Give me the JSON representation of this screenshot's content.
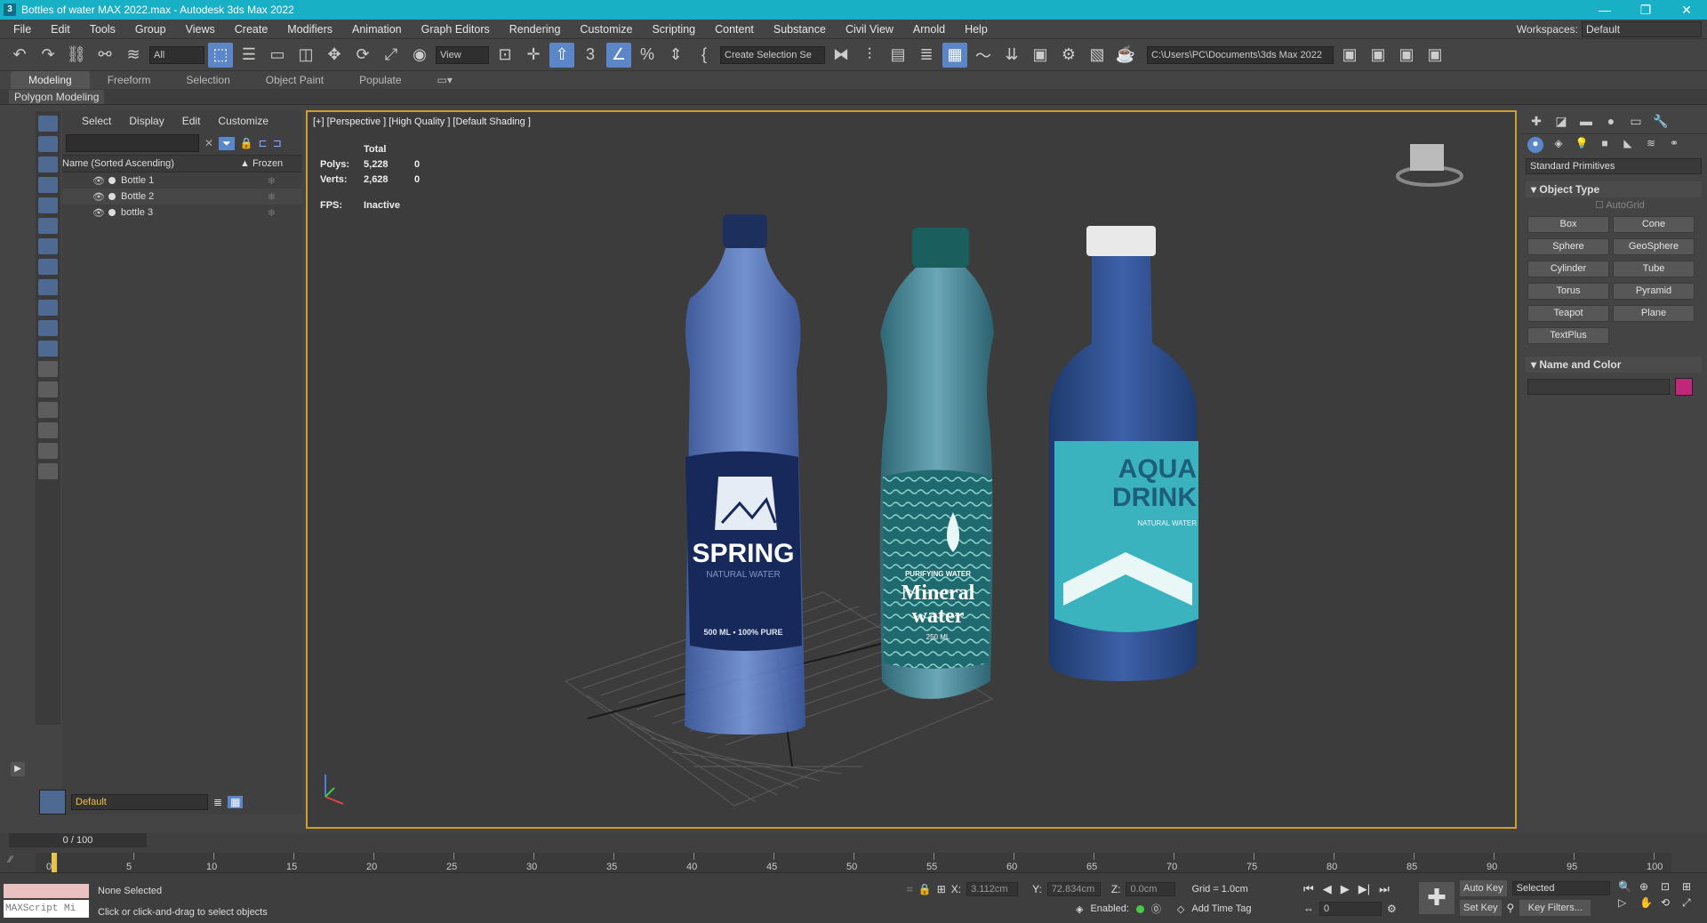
{
  "window": {
    "title": "Bottles of water MAX 2022.max - Autodesk 3ds Max 2022",
    "logo_text": "3",
    "controls": [
      "—",
      "❐",
      "✕"
    ]
  },
  "menu": {
    "items": [
      "File",
      "Edit",
      "Tools",
      "Group",
      "Views",
      "Create",
      "Modifiers",
      "Animation",
      "Graph Editors",
      "Rendering",
      "Customize",
      "Scripting",
      "Content",
      "Substance",
      "Civil View",
      "Arnold",
      "Help"
    ],
    "workspace_label": "Workspaces:",
    "workspace_value": "Default"
  },
  "toolbar": {
    "filter_value": "All",
    "view_value": "View",
    "selection_set": "Create Selection Se",
    "project_path": "C:\\Users\\PC\\Documents\\3ds Max 2022"
  },
  "ribbon": {
    "tabs": [
      "Modeling",
      "Freeform",
      "Selection",
      "Object Paint",
      "Populate"
    ],
    "sub": "Polygon Modeling"
  },
  "scene_explorer": {
    "tabs": [
      "Select",
      "Display",
      "Edit",
      "Customize"
    ],
    "col_name": "Name (Sorted Ascending)",
    "col_frozen": "▲ Frozen",
    "objects": [
      "Bottle 1",
      "Bottle 2",
      "bottle 3"
    ],
    "layer": "Default"
  },
  "viewport": {
    "label": "[+] [Perspective ] [High Quality ] [Default Shading ]",
    "stats": {
      "total_label": "Total",
      "polys_label": "Polys:",
      "polys_value": "5,228",
      "polys_sel": "0",
      "verts_label": "Verts:",
      "verts_value": "2,628",
      "verts_sel": "0",
      "fps_label": "FPS:",
      "fps_value": "Inactive"
    },
    "bottles": {
      "b1_brand": "SPRING",
      "b1_sub": "NATURAL WATER",
      "b1_size": "500 ML • 100% PURE",
      "b2_top": "PURIFYING WATER",
      "b2_brand1": "Mineral",
      "b2_brand2": "water",
      "b2_size": "250 ML",
      "b3_brand1": "AQUA",
      "b3_brand2": "DRINK",
      "b3_sub": "NATURAL WATER"
    }
  },
  "command_panel": {
    "dropdown": "Standard Primitives",
    "object_type": "Object Type",
    "autogrid": "AutoGrid",
    "buttons": [
      "Box",
      "Cone",
      "Sphere",
      "GeoSphere",
      "Cylinder",
      "Tube",
      "Torus",
      "Pyramid",
      "Teapot",
      "Plane",
      "TextPlus"
    ],
    "name_color": "Name and Color",
    "color": "#c1287b"
  },
  "timeline": {
    "frame": "0 / 100",
    "ticks": [
      "0",
      "5",
      "10",
      "15",
      "20",
      "25",
      "30",
      "35",
      "40",
      "45",
      "50",
      "55",
      "60",
      "65",
      "70",
      "75",
      "80",
      "85",
      "90",
      "95",
      "100"
    ]
  },
  "status": {
    "maxscript": "MAXScript Mi",
    "selection": "None Selected",
    "prompt": "Click or click-and-drag to select objects",
    "x_label": "X:",
    "x_value": "3.112cm",
    "y_label": "Y:",
    "y_value": "72.834cm",
    "z_label": "Z:",
    "z_value": "0.0cm",
    "grid": "Grid = 1.0cm",
    "enabled": "Enabled:",
    "add_time_tag": "Add Time Tag",
    "auto_key": "Auto Key",
    "set_key": "Set Key",
    "selected": "Selected",
    "key_filters": "Key Filters...",
    "frame_field": "0"
  }
}
